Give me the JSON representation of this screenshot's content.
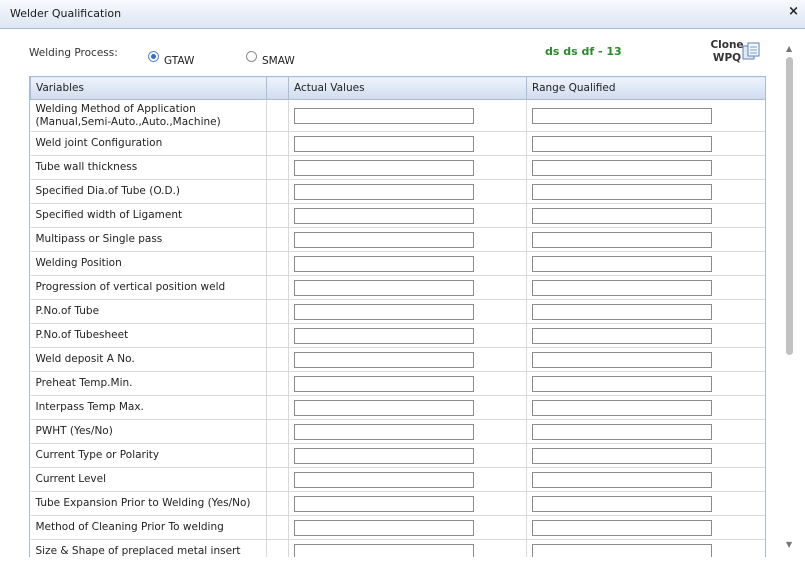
{
  "window": {
    "title": "Welder Qualification",
    "close": "×"
  },
  "process": {
    "label": "Welding Process:",
    "options": [
      "GTAW",
      "SMAW"
    ],
    "selected": "GTAW"
  },
  "code": "ds ds df - 13",
  "clone": {
    "label_line1": "Clone",
    "label_line2": "WPQ",
    "icon": "clone-document-icon"
  },
  "table": {
    "headers": [
      "Variables",
      "",
      "Actual Values",
      "Range Qualified"
    ],
    "rows": [
      {
        "variable": "Welding Method of Application (Manual,Semi-Auto.,Auto.,Machine)",
        "actual": "",
        "range": ""
      },
      {
        "variable": "Weld joint Configuration",
        "actual": "",
        "range": ""
      },
      {
        "variable": "Tube wall thickness",
        "actual": "",
        "range": ""
      },
      {
        "variable": "Specified Dia.of Tube (O.D.)",
        "actual": "",
        "range": ""
      },
      {
        "variable": "Specified width of Ligament",
        "actual": "",
        "range": ""
      },
      {
        "variable": "Multipass or Single pass",
        "actual": "",
        "range": ""
      },
      {
        "variable": "Welding Position",
        "actual": "",
        "range": ""
      },
      {
        "variable": "Progression of vertical position weld",
        "actual": "",
        "range": ""
      },
      {
        "variable": "P.No.of Tube",
        "actual": "",
        "range": ""
      },
      {
        "variable": "P.No.of Tubesheet",
        "actual": "",
        "range": ""
      },
      {
        "variable": "Weld deposit A No.",
        "actual": "",
        "range": ""
      },
      {
        "variable": "Preheat Temp.Min.",
        "actual": "",
        "range": ""
      },
      {
        "variable": "Interpass Temp Max.",
        "actual": "",
        "range": ""
      },
      {
        "variable": "PWHT (Yes/No)",
        "actual": "",
        "range": ""
      },
      {
        "variable": "Current Type or Polarity",
        "actual": "",
        "range": ""
      },
      {
        "variable": "Current Level",
        "actual": "",
        "range": ""
      },
      {
        "variable": "Tube Expansion Prior to Welding (Yes/No)",
        "actual": "",
        "range": ""
      },
      {
        "variable": "Method of Cleaning Prior To welding",
        "actual": "",
        "range": ""
      },
      {
        "variable": "Size & Shape of preplaced metal insert",
        "actual": "",
        "range": ""
      }
    ]
  },
  "colors": {
    "accent": "#2b6fd6",
    "code_text": "#2a8a2a",
    "header_border": "#a9bcd8"
  }
}
